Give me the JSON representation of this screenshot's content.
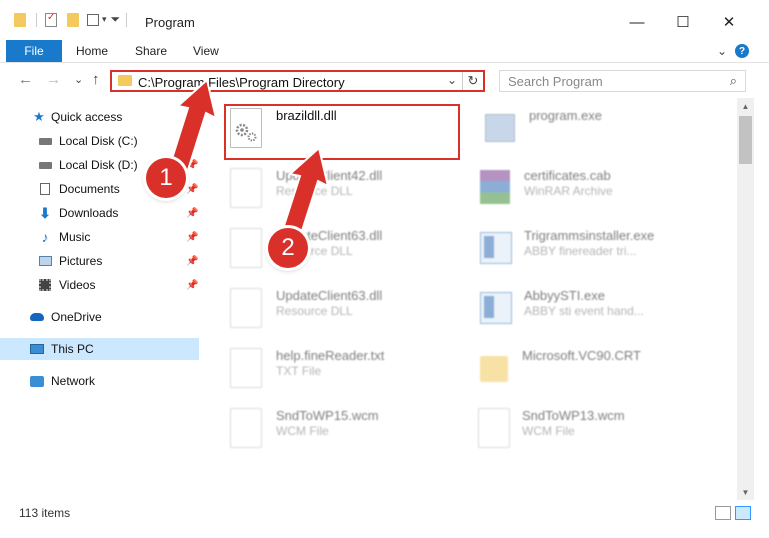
{
  "window": {
    "title": "Program",
    "minimize": "—",
    "maximize": "☐",
    "close": "✕"
  },
  "ribbon": {
    "tabs": [
      "File",
      "Home",
      "Share",
      "View"
    ],
    "expand": "⌄",
    "help": "?"
  },
  "nav": {
    "back": "←",
    "forward": "→",
    "recent": "⌄",
    "up": "↑",
    "address": "C:\\Program Files\\Program Directory",
    "address_dropdown": "⌄",
    "refresh": "↻",
    "search_placeholder": "Search Program",
    "search_glyph": "⌕"
  },
  "sidebar": {
    "items": [
      {
        "label": "Quick access",
        "icon": "star-icon",
        "pinned": false
      },
      {
        "label": "Local Disk (C:)",
        "icon": "drive-icon",
        "pinned": true
      },
      {
        "label": "Local Disk (D:)",
        "icon": "drive-icon",
        "pinned": true
      },
      {
        "label": "Documents",
        "icon": "documents-icon",
        "pinned": true
      },
      {
        "label": "Downloads",
        "icon": "download-icon",
        "pinned": true
      },
      {
        "label": "Music",
        "icon": "music-icon",
        "pinned": true
      },
      {
        "label": "Pictures",
        "icon": "pictures-icon",
        "pinned": true
      },
      {
        "label": "Videos",
        "icon": "video-icon",
        "pinned": true
      },
      {
        "label": "OneDrive",
        "icon": "cloud-icon",
        "pinned": false
      },
      {
        "label": "This PC",
        "icon": "computer-icon",
        "pinned": false
      },
      {
        "label": "Network",
        "icon": "network-icon",
        "pinned": false
      }
    ]
  },
  "files": [
    {
      "name": "brazildll.dll",
      "type": "",
      "icon": "dll-gear-icon",
      "highlighted": true
    },
    {
      "name": "program.exe",
      "type": "",
      "icon": "exe-icon"
    },
    {
      "name": "UpdateClient42.dll",
      "type": "Resource DLL",
      "icon": "dll-gear-icon"
    },
    {
      "name": "certificates.cab",
      "type": "WinRAR Archive",
      "icon": "archive-icon"
    },
    {
      "name": "UpdateClient63.dll",
      "type": "Resource DLL",
      "icon": "dll-gear-icon"
    },
    {
      "name": "Trigrammsinstaller.exe",
      "type": "ABBY finereader tri...",
      "icon": "installer-icon"
    },
    {
      "name": "UpdateClient63.dll",
      "type": "Resource DLL",
      "icon": "dll-gear-icon"
    },
    {
      "name": "AbbyySTI.exe",
      "type": "ABBY sti event hand...",
      "icon": "installer-icon"
    },
    {
      "name": "help.fineReader.txt",
      "type": "TXT File",
      "icon": "text-file-icon"
    },
    {
      "name": "Microsoft.VC90.CRT",
      "type": "",
      "icon": "folder-icon"
    },
    {
      "name": "SndToWP15.wcm",
      "type": "WCM File",
      "icon": "blank-file-icon"
    },
    {
      "name": "SndToWP13.wcm",
      "type": "WCM File",
      "icon": "blank-file-icon"
    }
  ],
  "status": {
    "item_count": "113 items"
  },
  "callouts": [
    "1",
    "2"
  ],
  "colors": {
    "accent": "#1979ca",
    "highlight_red": "#d9302a",
    "selected_bg": "#cce8ff"
  }
}
